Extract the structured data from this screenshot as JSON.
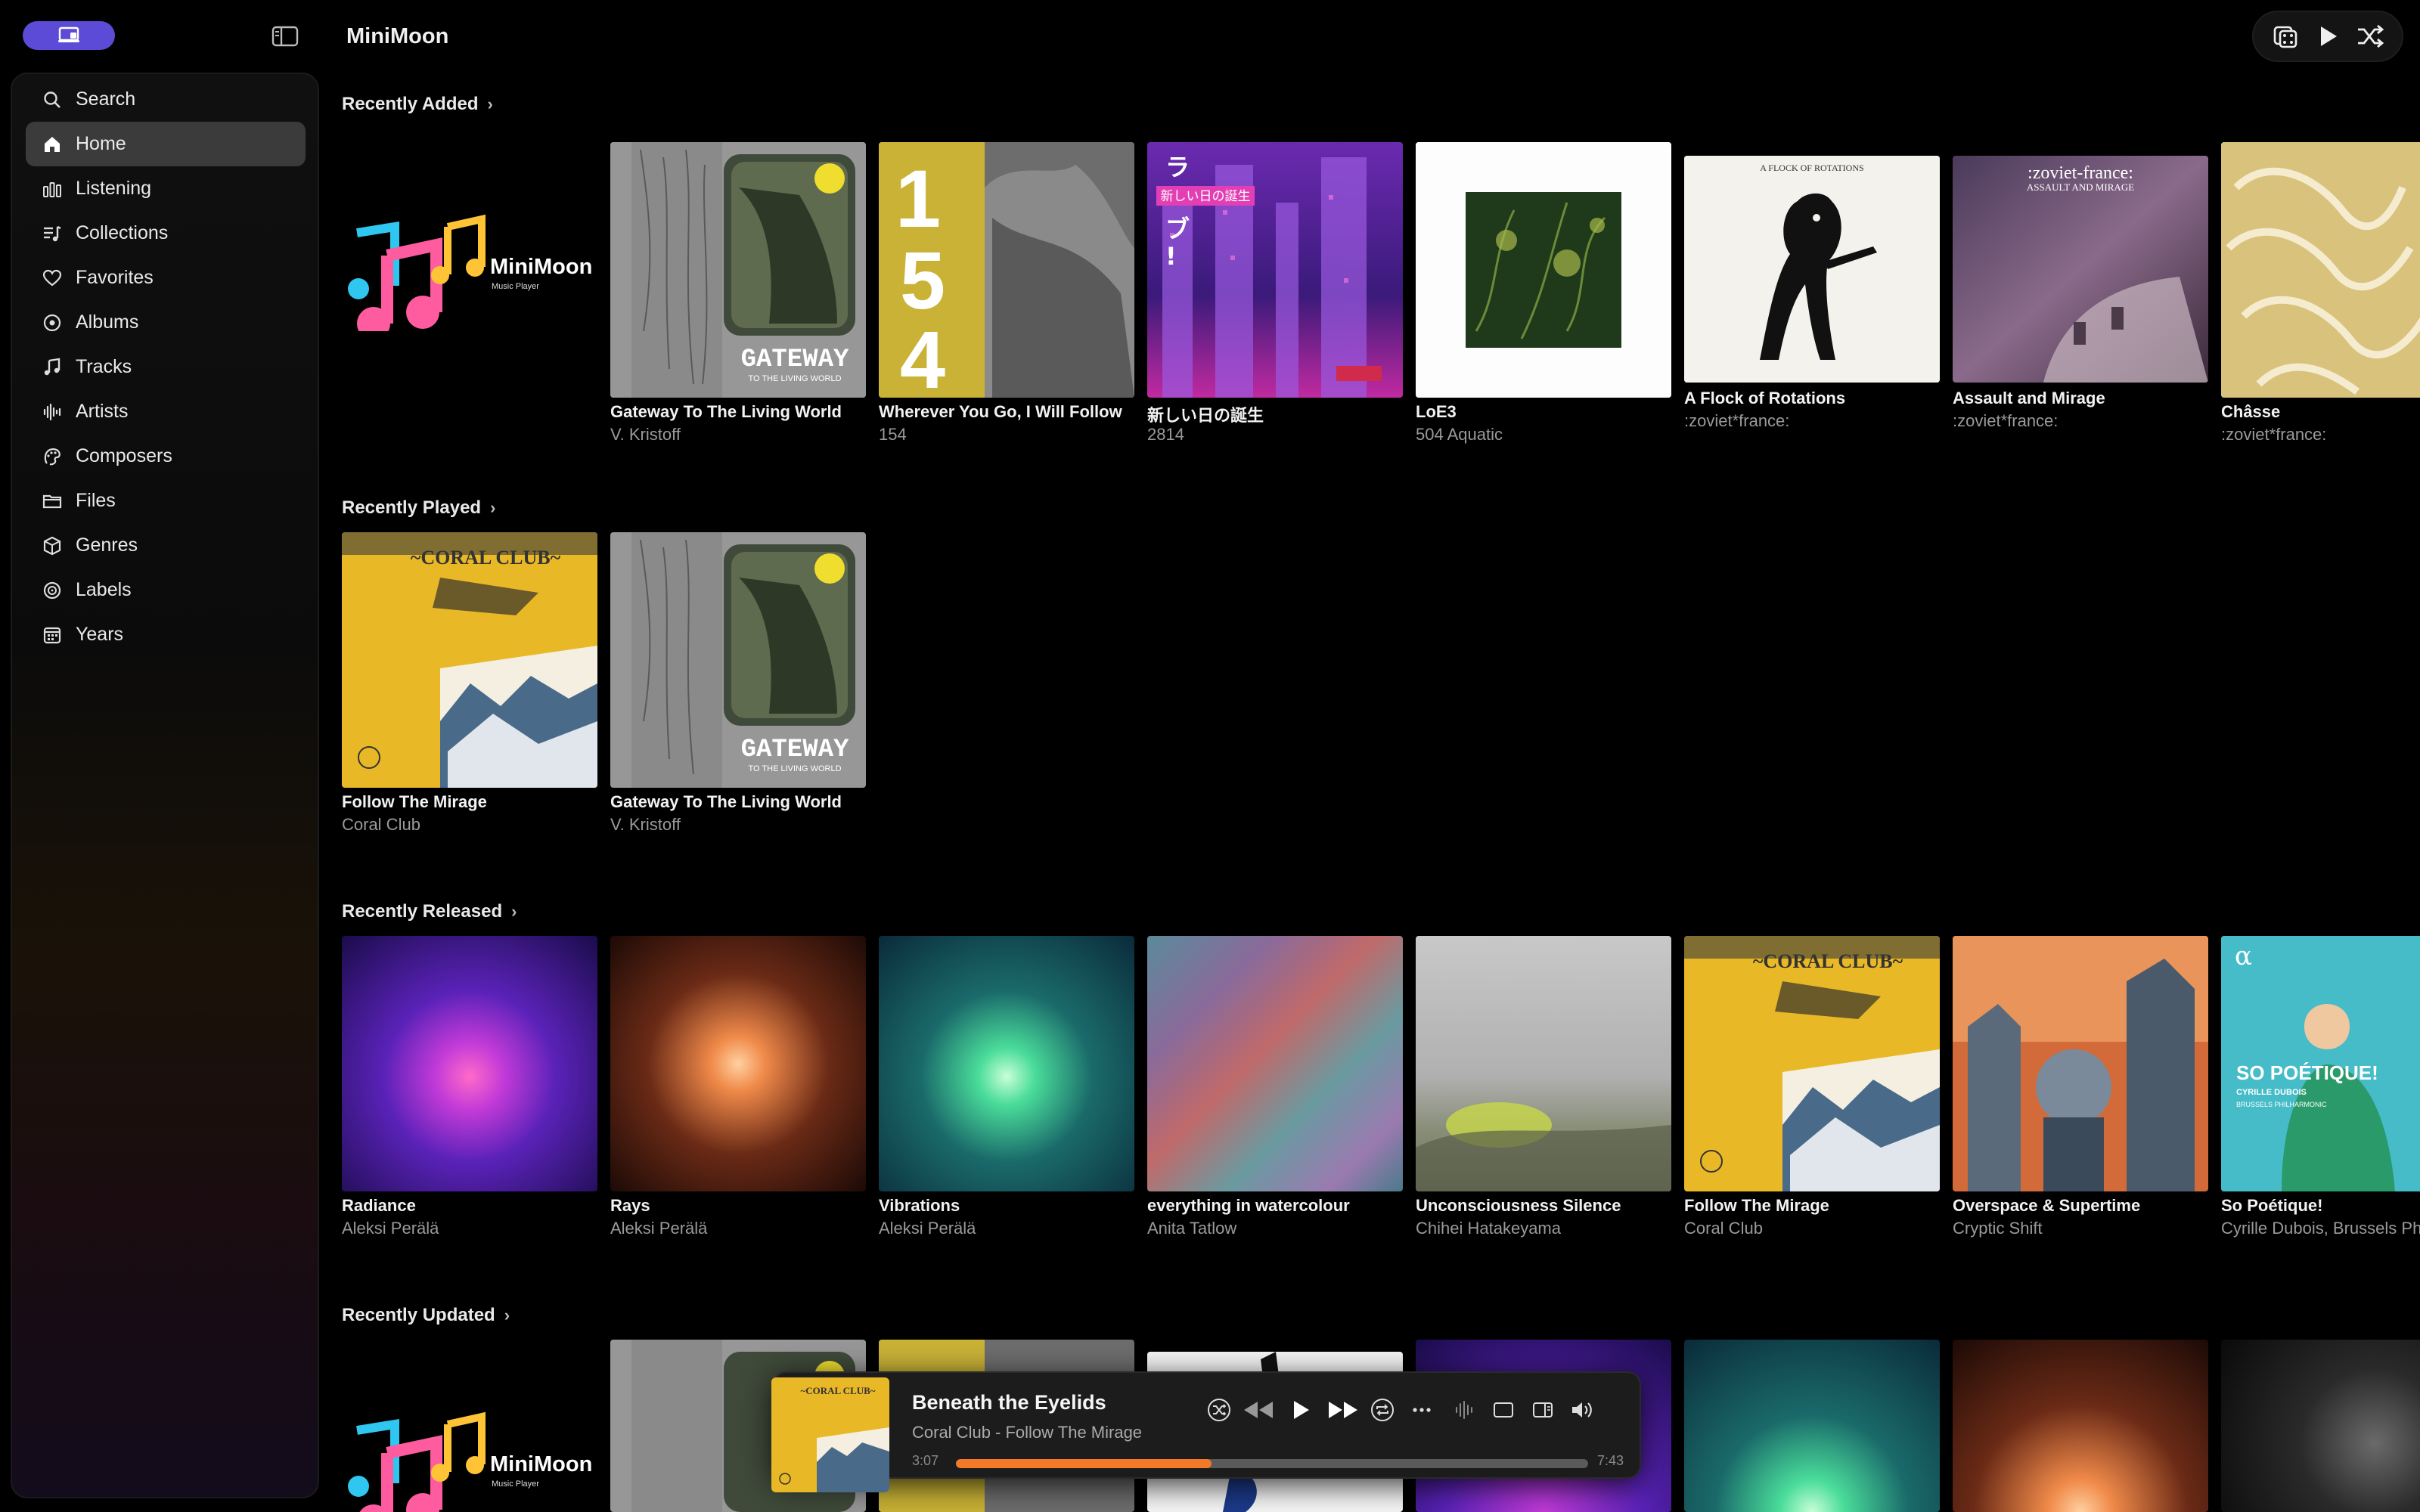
{
  "app": {
    "title": "MiniMoon"
  },
  "sidebar": {
    "items": [
      {
        "label": "Search",
        "icon": "search-icon"
      },
      {
        "label": "Home",
        "icon": "home-icon",
        "active": true
      },
      {
        "label": "Listening",
        "icon": "bars-icon"
      },
      {
        "label": "Collections",
        "icon": "collections-icon"
      },
      {
        "label": "Favorites",
        "icon": "heart-icon"
      },
      {
        "label": "Albums",
        "icon": "album-icon"
      },
      {
        "label": "Tracks",
        "icon": "music-note-icon"
      },
      {
        "label": "Artists",
        "icon": "waveform-icon"
      },
      {
        "label": "Composers",
        "icon": "composer-icon"
      },
      {
        "label": "Files",
        "icon": "folder-icon"
      },
      {
        "label": "Genres",
        "icon": "cube-icon"
      },
      {
        "label": "Labels",
        "icon": "label-icon"
      },
      {
        "label": "Years",
        "icon": "calendar-icon"
      }
    ]
  },
  "logo": {
    "name": "MiniMoon",
    "tagline": "Music Player"
  },
  "sections": {
    "recently_added": {
      "title": "Recently Added",
      "items": [
        {
          "title": "",
          "subtitle": ""
        },
        {
          "title": "Gateway To The Living World",
          "subtitle": "V. Kristoff"
        },
        {
          "title": "Wherever You Go, I Will Follow",
          "subtitle": "154"
        },
        {
          "title": "新しい日の誕生",
          "subtitle": "2814"
        },
        {
          "title": "LoE3",
          "subtitle": "504 Aquatic"
        },
        {
          "title": "A Flock of Rotations",
          "subtitle": ":zoviet*france:"
        },
        {
          "title": "Assault and Mirage",
          "subtitle": ":zoviet*france:"
        },
        {
          "title": "Châsse",
          "subtitle": ":zoviet*france:"
        }
      ]
    },
    "recently_played": {
      "title": "Recently Played",
      "items": [
        {
          "title": "Follow The Mirage",
          "subtitle": "Coral Club"
        },
        {
          "title": "Gateway To The Living World",
          "subtitle": "V. Kristoff"
        }
      ]
    },
    "recently_released": {
      "title": "Recently Released",
      "items": [
        {
          "title": "Radiance",
          "subtitle": "Aleksi Perälä"
        },
        {
          "title": "Rays",
          "subtitle": "Aleksi Perälä"
        },
        {
          "title": "Vibrations",
          "subtitle": "Aleksi Perälä"
        },
        {
          "title": "everything in watercolour",
          "subtitle": "Anita Tatlow"
        },
        {
          "title": "Unconsciousness Silence",
          "subtitle": "Chihei Hatakeyama"
        },
        {
          "title": "Follow The Mirage",
          "subtitle": "Coral Club"
        },
        {
          "title": "Overspace & Supertime",
          "subtitle": "Cryptic Shift"
        },
        {
          "title": "So Poétique!",
          "subtitle": "Cyrille Dubois, Brussels Philharmonic"
        }
      ]
    },
    "recently_updated": {
      "title": "Recently Updated"
    }
  },
  "artwork_text": {
    "gateway_title": "GATEWAY",
    "gateway_sub": "TO THE LIVING WORLD",
    "wherever_digits": [
      "1",
      "5",
      "4"
    ],
    "birth_title": "新しい日の誕生",
    "birth_katakana": [
      "ラ",
      "ブ",
      "!"
    ],
    "flock_header": "A FLOCK OF ROTATIONS",
    "assault_header1": ":zoviet-france:",
    "assault_header2": "ASSAULT AND MIRAGE",
    "coral_title": "~CORAL CLUB~",
    "so_poetique_title": "SO POÉTIQUE!",
    "so_poetique_artist": "CYRILLE DUBOIS",
    "so_poetique_orch": "BRUSSELS PHILHARMONIC",
    "alpha": "α"
  },
  "player": {
    "title": "Beneath the Eyelids",
    "subtitle": "Coral Club - Follow The Mirage",
    "elapsed": "3:07",
    "total": "7:43",
    "progress": 0.404
  },
  "colors": {
    "accent": "#5b4bd6",
    "progress": "#f07a2a"
  }
}
